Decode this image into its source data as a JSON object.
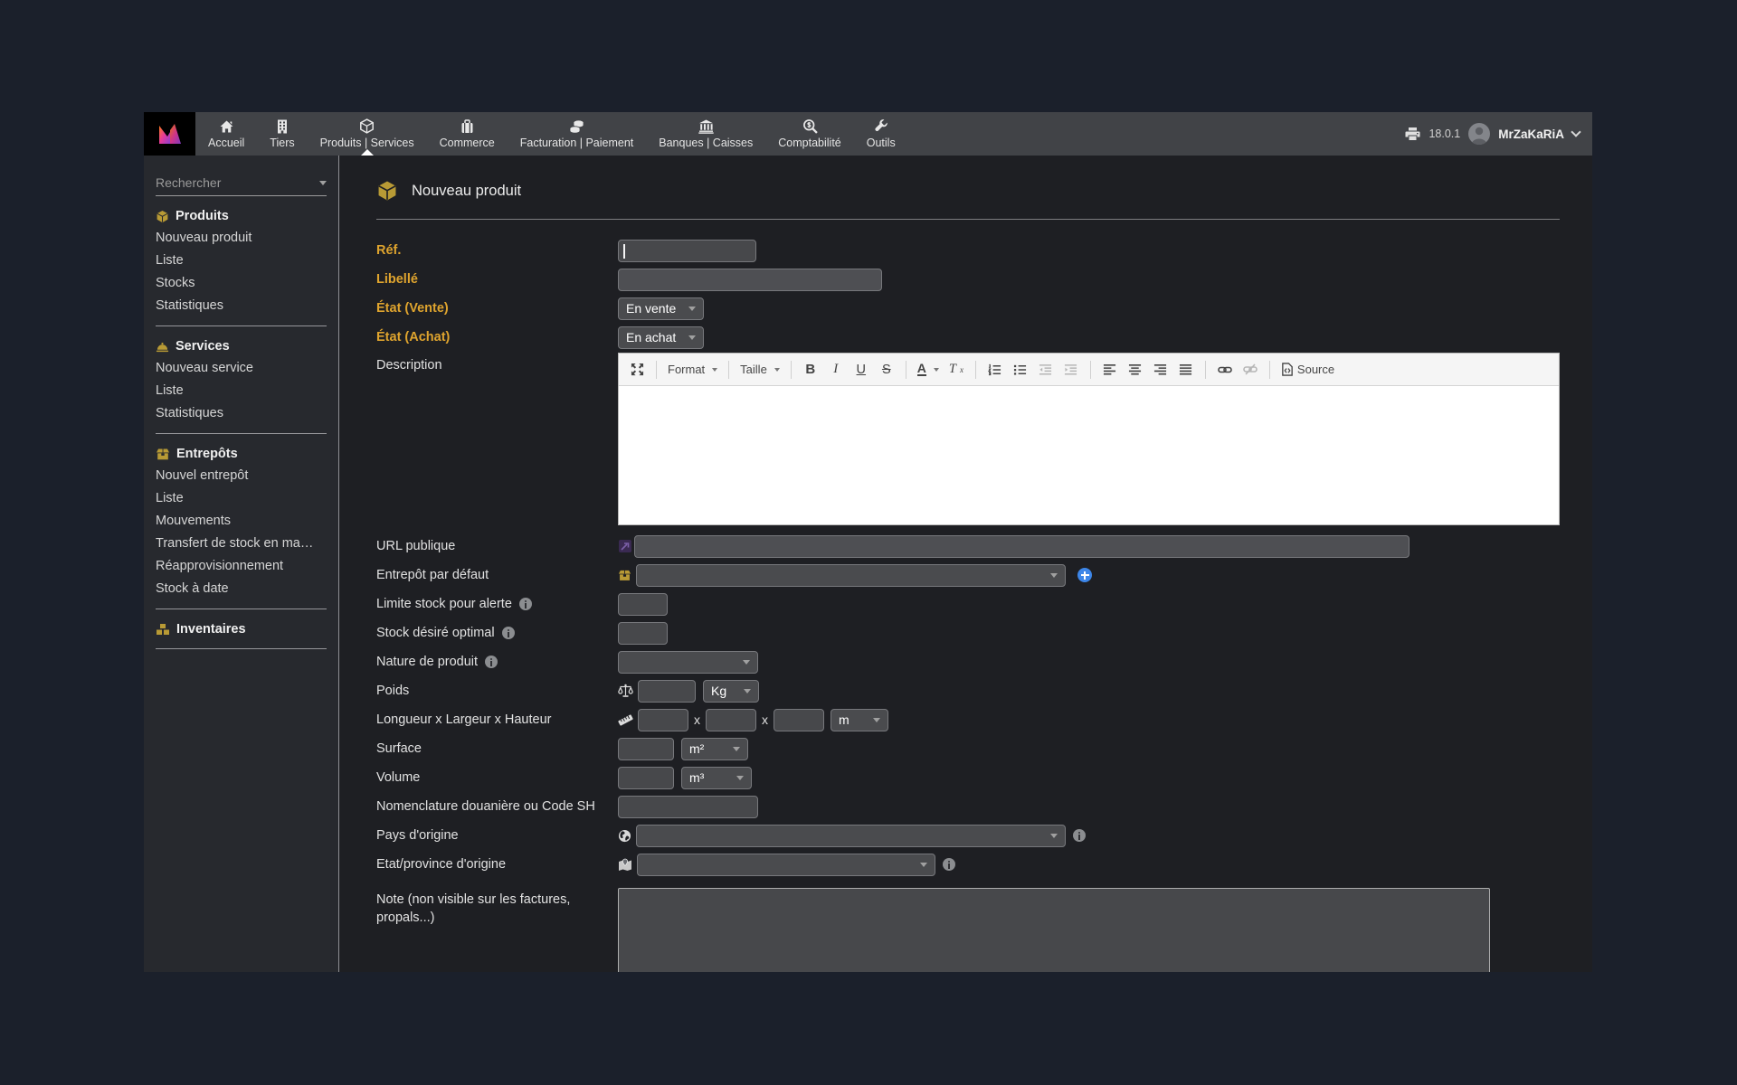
{
  "colors": {
    "outer_background": "#1b202b",
    "topbar": "#414347",
    "gold_accent": "#b89a35",
    "required_label": "#dfa42e",
    "link_blue": "#3d86e8",
    "purple_icon": "#43275c"
  },
  "topbar": {
    "menu": [
      {
        "label": "Accueil",
        "icon": "home-icon"
      },
      {
        "label": "Tiers",
        "icon": "building-icon"
      },
      {
        "label": "Produits | Services",
        "icon": "cube-icon",
        "active": true
      },
      {
        "label": "Commerce",
        "icon": "briefcase-icon"
      },
      {
        "label": "Facturation | Paiement",
        "icon": "coins-icon"
      },
      {
        "label": "Banques | Caisses",
        "icon": "bank-icon"
      },
      {
        "label": "Comptabilité",
        "icon": "search-dollar-icon"
      },
      {
        "label": "Outils",
        "icon": "wrench-icon"
      }
    ],
    "version": "18.0.1",
    "user": "MrZaKaRiA"
  },
  "sidebar": {
    "search_placeholder": "Rechercher",
    "sections": [
      {
        "title": "Produits",
        "icon": "cube-icon",
        "items": [
          "Nouveau produit",
          "Liste",
          "Stocks",
          "Statistiques"
        ]
      },
      {
        "title": "Services",
        "icon": "cloche-icon",
        "items": [
          "Nouveau service",
          "Liste",
          "Statistiques"
        ]
      },
      {
        "title": "Entrepôts",
        "icon": "warehouse-icon",
        "items": [
          "Nouvel entrepôt",
          "Liste",
          "Mouvements",
          "Transfert de stock en ma…",
          "Réapprovisionnement",
          "Stock à date"
        ]
      },
      {
        "title": "Inventaires",
        "icon": "cubes-icon",
        "items": []
      }
    ]
  },
  "main": {
    "title": "Nouveau produit",
    "fields": {
      "ref": {
        "label": "Réf.",
        "value": ""
      },
      "libelle": {
        "label": "Libellé",
        "value": ""
      },
      "etat_vente": {
        "label": "État (Vente)",
        "value": "En vente"
      },
      "etat_achat": {
        "label": "État (Achat)",
        "value": "En achat"
      },
      "description": {
        "label": "Description",
        "value": ""
      },
      "url_publique": {
        "label": "URL publique",
        "value": ""
      },
      "entrepot": {
        "label": "Entrepôt par défaut",
        "value": ""
      },
      "limite_stock": {
        "label": "Limite stock pour alerte",
        "value": ""
      },
      "stock_desire": {
        "label": "Stock désiré optimal",
        "value": ""
      },
      "nature": {
        "label": "Nature de produit",
        "value": ""
      },
      "poids": {
        "label": "Poids",
        "value": "",
        "unit": "Kg"
      },
      "dimensions": {
        "label": "Longueur x Largeur x Hauteur",
        "separator": "x",
        "unit": "m"
      },
      "surface": {
        "label": "Surface",
        "value": "",
        "unit": "m²"
      },
      "volume": {
        "label": "Volume",
        "value": "",
        "unit": "m³"
      },
      "nomenclature": {
        "label": "Nomenclature douanière ou Code SH",
        "value": ""
      },
      "pays": {
        "label": "Pays d'origine",
        "value": ""
      },
      "etat_province": {
        "label": "Etat/province d'origine",
        "value": ""
      },
      "note": {
        "label": "Note (non visible sur les factures, propals...)",
        "value": ""
      }
    }
  },
  "editor": {
    "format_label": "Format",
    "size_label": "Taille",
    "bold": "B",
    "italic": "I",
    "underline": "U",
    "strike": "S",
    "color": "A",
    "remove_format": "T",
    "remove_format_sub": "x",
    "source_label": "Source"
  }
}
